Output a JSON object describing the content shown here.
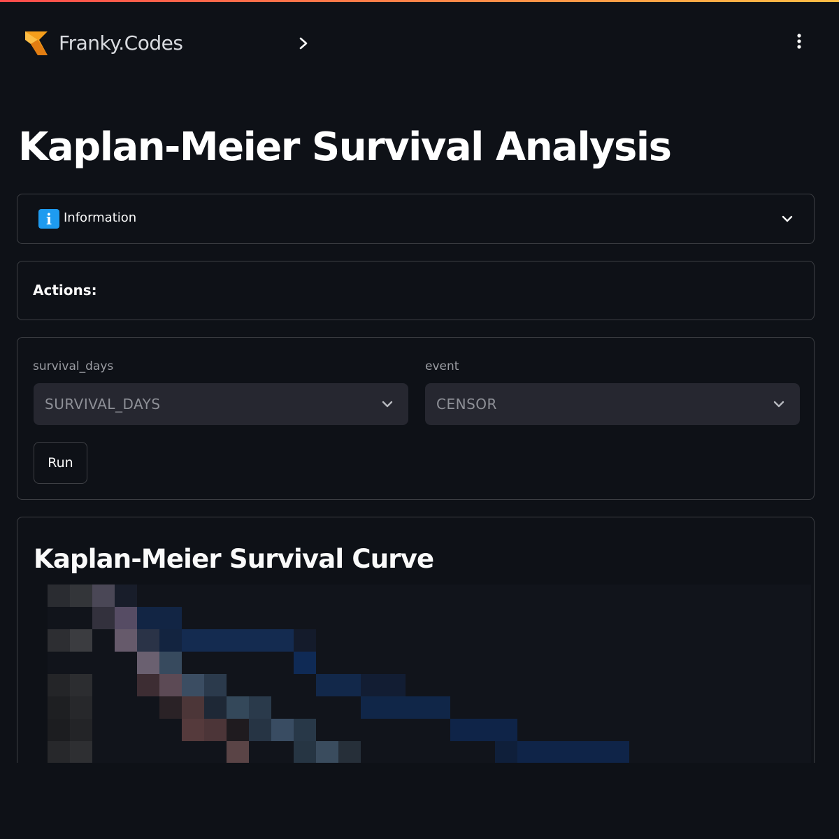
{
  "app": {
    "brand": "Franky.Codes",
    "icons": {
      "expand": "chevron-right-icon",
      "menu": "vertical-ellipsis-icon",
      "logo": "franky-logo-icon"
    },
    "colors": {
      "background": "#0e1117",
      "gradient_start": "#ff4b4b",
      "gradient_end": "#ffbd45",
      "info_blue": "#1e9bf0"
    }
  },
  "page": {
    "title": "Kaplan-Meier Survival Analysis"
  },
  "info_expander": {
    "icon_glyph": "i",
    "icon": "info-icon",
    "label": "Information",
    "expanded": false
  },
  "actions": {
    "label": "Actions:"
  },
  "form": {
    "survival_field": {
      "label": "survival_days",
      "value": "SURVIVAL_DAYS"
    },
    "event_field": {
      "label": "event",
      "value": "CENSOR"
    },
    "run_label": "Run"
  },
  "chart_section": {
    "title": "Kaplan-Meier Survival Curve",
    "image_note": "pixelated chart image",
    "colors": {
      "series_blue": "#0f2a55",
      "series_pink": "#6b5a70",
      "series_red": "#5c3a3a"
    }
  }
}
